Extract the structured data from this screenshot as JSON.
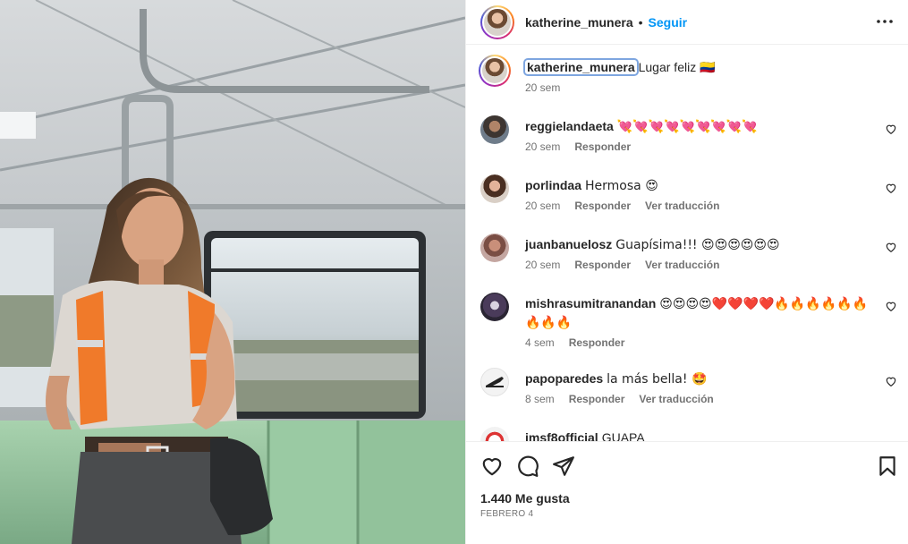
{
  "post": {
    "username": "katherine_munera",
    "separator": "•",
    "follow_label": "Seguir",
    "more_icon": "more-horizontal-icon"
  },
  "caption": {
    "username": "katherine_munera",
    "text": "Lugar feliz",
    "flag": "🇨🇴",
    "time": "20 sem"
  },
  "comments": [
    {
      "username": "reggielandaeta",
      "text": "💘💘💘💘💘💘💘💘💘",
      "time": "20 sem",
      "reply": "Responder",
      "translate": ""
    },
    {
      "username": "porlindaa",
      "text": "Hermosa 😍",
      "time": "20 sem",
      "reply": "Responder",
      "translate": "Ver traducción"
    },
    {
      "username": "juanbanuelosz",
      "text": "Guapísima!!! 😍😍😍😍😍😍",
      "time": "20 sem",
      "reply": "Responder",
      "translate": "Ver traducción"
    },
    {
      "username": "mishrasumitranandan",
      "text": "😍😍😍😍❤️❤️❤️❤️🔥🔥🔥🔥🔥🔥🔥🔥🔥",
      "time": "4 sem",
      "reply": "Responder",
      "translate": ""
    },
    {
      "username": "papoparedes",
      "text": "la más bella! 🤩",
      "time": "8 sem",
      "reply": "Responder",
      "translate": "Ver traducción"
    },
    {
      "username": "imsf8official",
      "text": "GUAPA",
      "time": "",
      "reply": "",
      "translate": ""
    }
  ],
  "footer": {
    "likes": "1.440 Me gusta",
    "date": "FEBRERO 4"
  },
  "icons": {
    "like": "heart-icon",
    "comment": "comment-icon",
    "share": "share-icon",
    "save": "bookmark-icon"
  },
  "colors": {
    "accent": "#0095f6",
    "text": "#262626",
    "muted": "#737373",
    "border": "#efefef",
    "vest": "#f07a2a",
    "seat": "#8fc19a"
  }
}
